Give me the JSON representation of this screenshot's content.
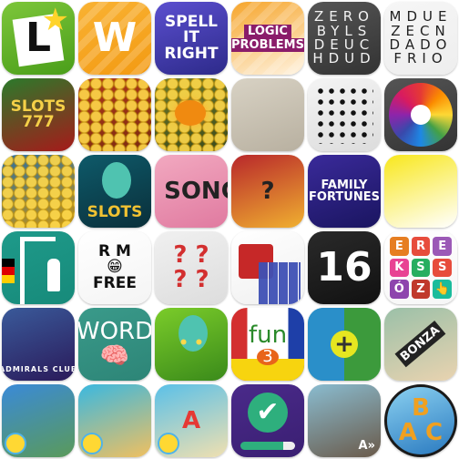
{
  "icons": [
    {
      "name": "learner-app",
      "bg": [
        "#7dc63a",
        "#4a9e1a"
      ],
      "fg": "#111",
      "size": "xl",
      "lines": [
        "L"
      ],
      "deco": [
        "card",
        "star"
      ]
    },
    {
      "name": "wordbrain-app",
      "bg": [
        "#f9b233",
        "#f39a12"
      ],
      "fg": "#fff",
      "size": "xl",
      "lines": [
        "W"
      ],
      "deco": [
        "stripes"
      ]
    },
    {
      "name": "spell-it-right-app",
      "bg": [
        "#5b4fcf",
        "#2d2a8a"
      ],
      "fg": "#fff",
      "size": "m",
      "lines": [
        "SPELL",
        "IT",
        "RIGHT"
      ],
      "deco": []
    },
    {
      "name": "logic-problems-app",
      "bg": [
        "#f6a52b",
        "#fff3e0"
      ],
      "fg": "#fff",
      "size": "s",
      "lines": [
        "LOGIC",
        "PROBLEMS"
      ],
      "boxed": "#8a1c6a",
      "deco": [
        "stripes"
      ]
    },
    {
      "name": "word-search-app",
      "bg": [
        "#555555",
        "#333333"
      ],
      "fg": "#f2f2f2",
      "size": "grid",
      "lines": [
        "ZERO",
        "BYLS",
        "DEUC",
        "HDUD"
      ],
      "deco": []
    },
    {
      "name": "word-search-es-app",
      "bg": [
        "#f6f6f6",
        "#eeeeee"
      ],
      "fg": "#222",
      "size": "grid",
      "lines": [
        "MDUE",
        "ZECN",
        "DADO",
        "FRIO"
      ],
      "deco": []
    },
    {
      "name": "slots-777-app",
      "bg": [
        "#2b7a2b",
        "#a61a1a"
      ],
      "fg": "#f5d048",
      "size": "m",
      "lines": [
        "SLOTS",
        "777"
      ],
      "deco": []
    },
    {
      "name": "coin-dozer-app",
      "bg": [
        "#b33a1a",
        "#7a2a10"
      ],
      "fg": "#fff",
      "size": "m",
      "lines": [],
      "deco": [
        "coins"
      ]
    },
    {
      "name": "coin-pusher-halloween-app",
      "bg": [
        "#6f7a2a",
        "#3b4a1a"
      ],
      "fg": "#fff",
      "size": "m",
      "lines": [],
      "deco": [
        "coins",
        "pump"
      ]
    },
    {
      "name": "sketch-adventure-app",
      "bg": [
        "#d8d2c4",
        "#b8b0a0"
      ],
      "fg": "#333",
      "size": "m",
      "lines": [],
      "deco": []
    },
    {
      "name": "dots-connect-app",
      "bg": [
        "#f4f4f4",
        "#dcdcdc"
      ],
      "fg": "#111",
      "size": "m",
      "lines": [],
      "deco": [
        "dots"
      ]
    },
    {
      "name": "wheel-of-fortune-app",
      "bg": [
        "#555555",
        "#333333"
      ],
      "fg": "#111",
      "size": "m",
      "lines": [],
      "deco": [
        "wheel"
      ]
    },
    {
      "name": "coin-carnival-app",
      "bg": [
        "#2b6ea0",
        "#c99512"
      ],
      "fg": "#fff",
      "size": "m",
      "lines": [],
      "deco": [
        "coins"
      ]
    },
    {
      "name": "mystic-slots-app",
      "bg": [
        "#0e5a6a",
        "#0a2f3a"
      ],
      "fg": "#f1c232",
      "size": "m",
      "lines": [
        "SLOTS"
      ],
      "bottom": true,
      "deco": [
        "face"
      ]
    },
    {
      "name": "guess-the-song-app",
      "bg": [
        "#f2a9c0",
        "#e07aa0"
      ],
      "fg": "#222",
      "size": "l",
      "lines": [
        "? SONG"
      ],
      "deco": []
    },
    {
      "name": "4-pics-app",
      "bg": [
        "#b8272b",
        "#f0b030"
      ],
      "fg": "#222",
      "size": "l",
      "lines": [
        "?"
      ],
      "deco": []
    },
    {
      "name": "family-fortunes-app",
      "bg": [
        "#3a2a9a",
        "#1a1560"
      ],
      "fg": "#fff",
      "size": "s",
      "lines": [
        "FAMILY",
        "FORTUNES"
      ],
      "deco": []
    },
    {
      "name": "icon-quiz-app",
      "bg": [
        "#f8e71c",
        "#ffffff"
      ],
      "fg": "#222",
      "size": "m",
      "lines": [],
      "deco": []
    },
    {
      "name": "hangman-de-app",
      "bg": [
        "#1e9a8a",
        "#178a7a"
      ],
      "fg": "#fff",
      "size": "m",
      "lines": [],
      "deco": [
        "gallows",
        "person",
        "flag"
      ]
    },
    {
      "name": "rm-free-app",
      "bg": [
        "#ffffff",
        "#f4f4f4"
      ],
      "fg": "#111",
      "size": "m",
      "lines": [
        "R   M",
        "😁",
        "FREE"
      ],
      "deco": []
    },
    {
      "name": "pics-quiz-app",
      "bg": [
        "#f0f0f0",
        "#dddddd"
      ],
      "fg": "#d32f2f",
      "size": "l",
      "lines": [
        "?  ?",
        "?  ?"
      ],
      "deco": []
    },
    {
      "name": "gift-block-app",
      "bg": [
        "#ffffff",
        "#f0f0f0"
      ],
      "fg": "#111",
      "size": "m",
      "lines": [],
      "deco": [
        "box",
        "blocks"
      ]
    },
    {
      "name": "16-app",
      "bg": [
        "#2a2a2a",
        "#111111"
      ],
      "fg": "#fff",
      "size": "xl",
      "lines": [
        "16"
      ],
      "deco": []
    },
    {
      "name": "letter-blocks-app",
      "bg": [
        "#ffffff",
        "#f6f6f6"
      ],
      "fg": "#fff",
      "size": "m",
      "lines": [],
      "letters": [
        "E",
        "R",
        "E",
        "K",
        "S",
        "S",
        "Ó",
        "Z",
        "👆"
      ],
      "deco": [
        "letters"
      ]
    },
    {
      "name": "admirals-club-app",
      "bg": [
        "#3a5a9a",
        "#2a1a5a"
      ],
      "fg": "#fff",
      "size": "xs",
      "lines": [
        "ADMIRALS CLUB"
      ],
      "bottom": true,
      "deco": []
    },
    {
      "name": "word-brain-app",
      "bg": [
        "#3a9a8a",
        "#2d8577"
      ],
      "fg": "#fff",
      "size": "l",
      "lines": [
        "WORD",
        "🧠"
      ],
      "thin": true,
      "deco": []
    },
    {
      "name": "hooded-hero-app",
      "bg": [
        "#7bcc2a",
        "#3a8a1a"
      ],
      "fg": "#ffd84a",
      "size": "m",
      "lines": [
        "• •"
      ],
      "deco": [
        "face"
      ]
    },
    {
      "name": "fun-3-app",
      "bg": [
        "#ffffff",
        "#ffffff"
      ],
      "fg": "#2a8a2a",
      "size": "l",
      "lines": [
        "fun",
        "3"
      ],
      "thin": true,
      "deco": [
        "funbg",
        "funbot"
      ]
    },
    {
      "name": "weather-plus-app",
      "bg": [
        "#2a8fc9",
        "#3c9a3c"
      ],
      "fg": "#333",
      "size": "m",
      "lines": [],
      "deco": [
        "rain",
        "plus"
      ]
    },
    {
      "name": "bonza-app",
      "bg": [
        "#9bc0a8",
        "#e9d3b0"
      ],
      "fg": "#fff",
      "size": "s",
      "lines": [
        "BONZA"
      ],
      "dark": true,
      "deco": []
    },
    {
      "name": "science-kid-app",
      "bg": [
        "#3a8ad8",
        "#5a9a5a"
      ],
      "fg": "#fff",
      "size": "m",
      "lines": [],
      "deco": [
        "chick"
      ]
    },
    {
      "name": "beach-girl-app",
      "bg": [
        "#3ab8e0",
        "#f0c060"
      ],
      "fg": "#fff",
      "size": "m",
      "lines": [],
      "deco": [
        "chick"
      ]
    },
    {
      "name": "abc-kid-app",
      "bg": [
        "#5ac0e8",
        "#f0e0b0"
      ],
      "fg": "#e53935",
      "size": "l",
      "lines": [
        "A"
      ],
      "deco": [
        "chick"
      ]
    },
    {
      "name": "checklist-app",
      "bg": [
        "#4a2a8a",
        "#3a1f72"
      ],
      "fg": "#fff",
      "size": "m",
      "lines": [],
      "deco": [
        "check",
        "bar"
      ]
    },
    {
      "name": "space-dog-app",
      "bg": [
        "#8abcd0",
        "#6a5a4a"
      ],
      "fg": "#fff",
      "size": "s",
      "lines": [
        "A»"
      ],
      "corner": true,
      "deco": []
    },
    {
      "name": "abc-letters-app",
      "bg": [
        "#8ad0f0",
        "#2a7ac0"
      ],
      "fg": "#f0a020",
      "size": "l",
      "lines": [
        "B",
        "A C"
      ],
      "round": true,
      "deco": []
    }
  ],
  "colors": {
    "letterTiles": [
      "#e67e22",
      "#e74c3c",
      "#9b59b6",
      "#e84393",
      "#27ae60",
      "#e74c3c",
      "#8e44ad",
      "#c0392b",
      "#1abc9c"
    ]
  }
}
